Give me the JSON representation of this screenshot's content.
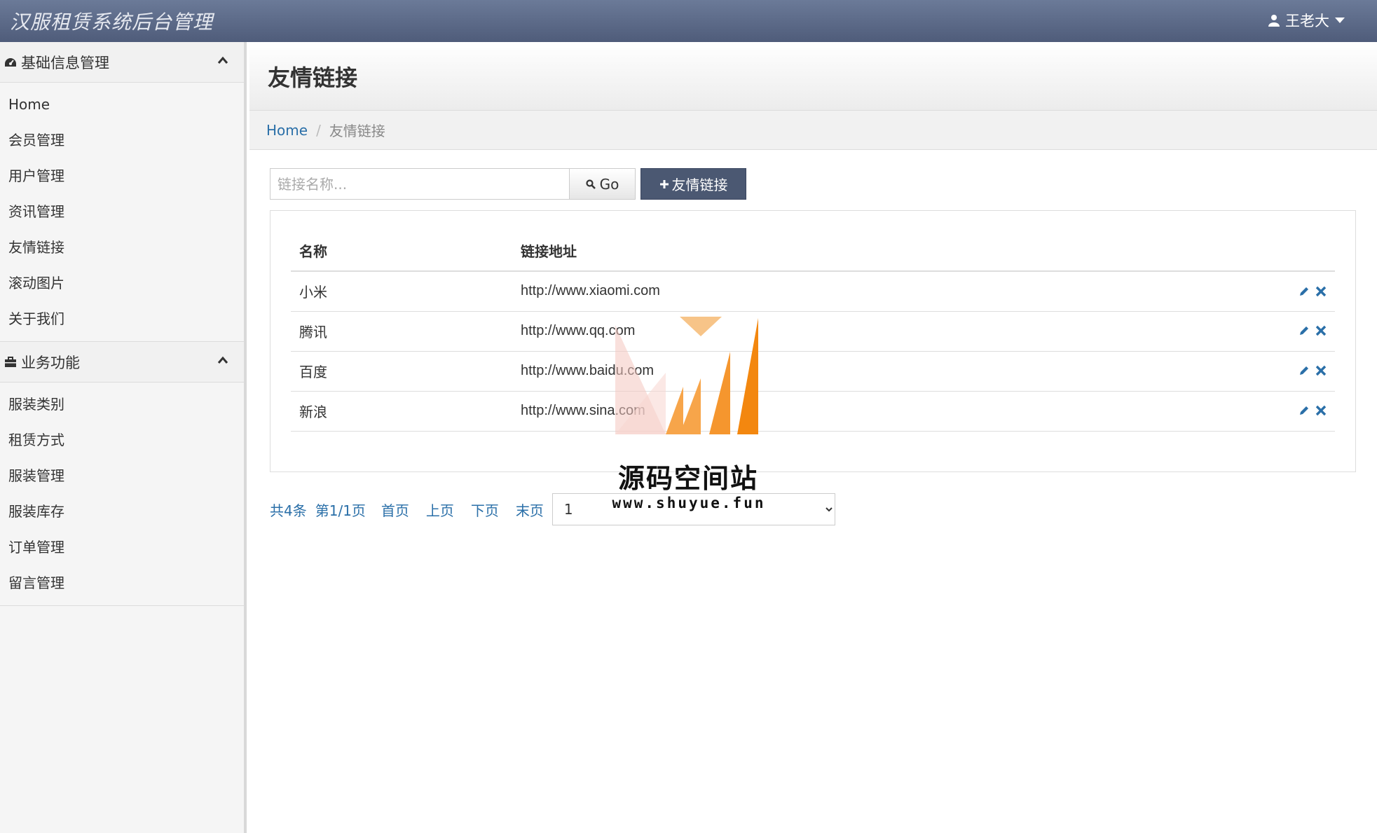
{
  "app": {
    "title": "汉服租赁系统后台管理",
    "user_name": "王老大"
  },
  "sidebar": {
    "groups": [
      {
        "title": "基础信息管理",
        "icon": "dashboard-icon",
        "items": [
          "Home",
          "会员管理",
          "用户管理",
          "资讯管理",
          "友情链接",
          "滚动图片",
          "关于我们"
        ]
      },
      {
        "title": "业务功能",
        "icon": "briefcase-icon",
        "items": [
          "服装类别",
          "租赁方式",
          "服装管理",
          "服装库存",
          "订单管理",
          "留言管理"
        ]
      }
    ]
  },
  "page": {
    "title": "友情链接",
    "breadcrumb": {
      "home": "Home",
      "current": "友情链接"
    }
  },
  "toolbar": {
    "search_placeholder": "链接名称...",
    "go_label": "Go",
    "add_label": "友情链接"
  },
  "table": {
    "headers": {
      "name": "名称",
      "url": "链接地址"
    },
    "rows": [
      {
        "name": "小米",
        "url": "http://www.xiaomi.com"
      },
      {
        "name": "腾讯",
        "url": "http://www.qq.com"
      },
      {
        "name": "百度",
        "url": "http://www.baidu.com"
      },
      {
        "name": "新浪",
        "url": "http://www.sina.com"
      }
    ]
  },
  "pager": {
    "total": "共4条",
    "page_info": "第1/1页",
    "first": "首页",
    "prev": "上页",
    "next": "下页",
    "last": "末页",
    "selected_page": "1"
  },
  "watermark": {
    "name": "源码空间站",
    "url": "www.shuyue.fun"
  },
  "colors": {
    "topbar": "#5a6786",
    "link": "#2a6fa8",
    "primary_button": "#4b5872",
    "icon_action": "#2a6fa8"
  }
}
